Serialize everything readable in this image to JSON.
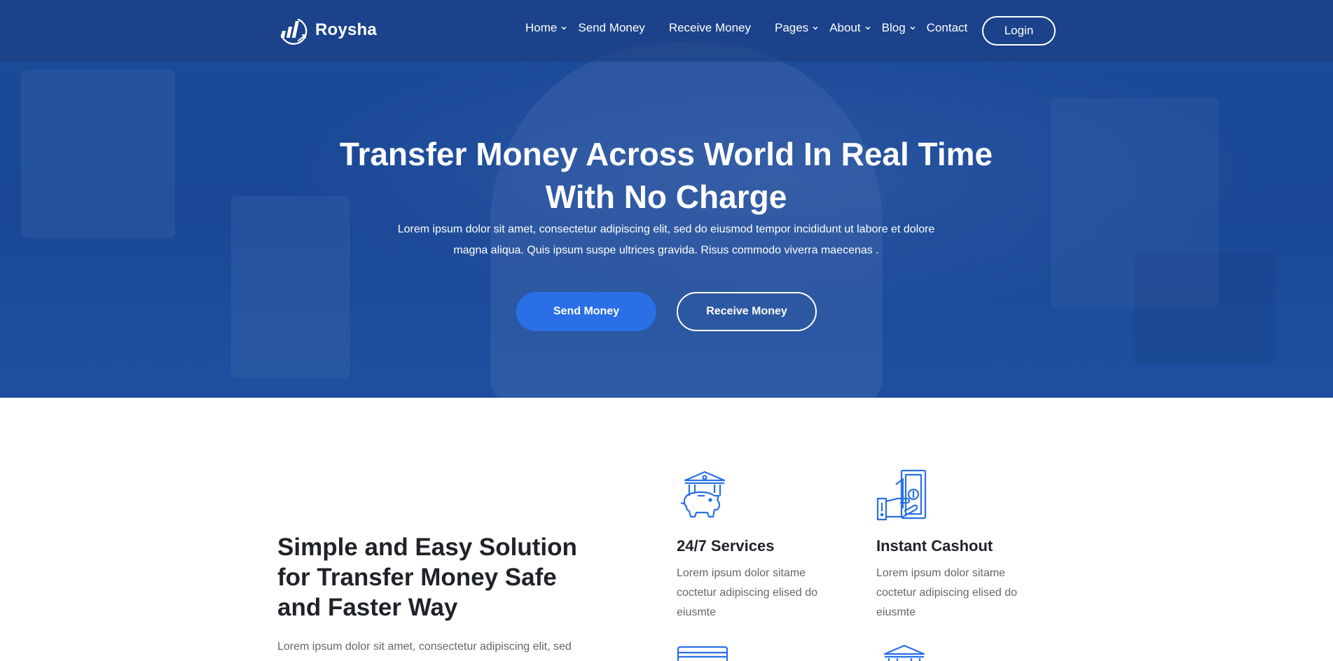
{
  "brand": {
    "name": "Roysha",
    "color": "#2a6fe6"
  },
  "nav": {
    "items": [
      {
        "label": "Home",
        "dropdown": true
      },
      {
        "label": "Send Money",
        "dropdown": false
      },
      {
        "label": "Receive Money",
        "dropdown": false
      },
      {
        "label": "Pages",
        "dropdown": true
      },
      {
        "label": "About",
        "dropdown": true
      },
      {
        "label": "Blog",
        "dropdown": true
      },
      {
        "label": "Contact",
        "dropdown": false
      }
    ],
    "login_label": "Login"
  },
  "hero": {
    "title_line1": "Transfer Money Across World In Real Time",
    "title_line2": "With No Charge",
    "subtitle_line1": "Lorem ipsum dolor sit amet, consectetur adipiscing elit, sed do eiusmod tempor incididunt ut labore et dolore",
    "subtitle_line2": "magna aliqua. Quis ipsum suspe ultrices gravida. Risus commodo viverra maecenas .",
    "primary_button": "Send Money",
    "secondary_button": "Receive Money"
  },
  "about": {
    "title_line1": "Simple and Easy Solution",
    "title_line2": "for Transfer Money Safe",
    "title_line3": "and Faster Way",
    "text": "Lorem ipsum dolor sit amet, consectetur adipiscing elit, sed"
  },
  "features": [
    {
      "icon": "bank-piggy-icon",
      "title": "24/7 Services",
      "text_line1": "Lorem ipsum dolor sitame",
      "text_line2": "coctetur adipiscing elised do",
      "text_line3": "eiusmte"
    },
    {
      "icon": "cash-hand-icon",
      "title": "Instant Cashout",
      "text_line1": "Lorem ipsum dolor sitame",
      "text_line2": "coctetur adipiscing elised do",
      "text_line3": "eiusmte"
    }
  ]
}
